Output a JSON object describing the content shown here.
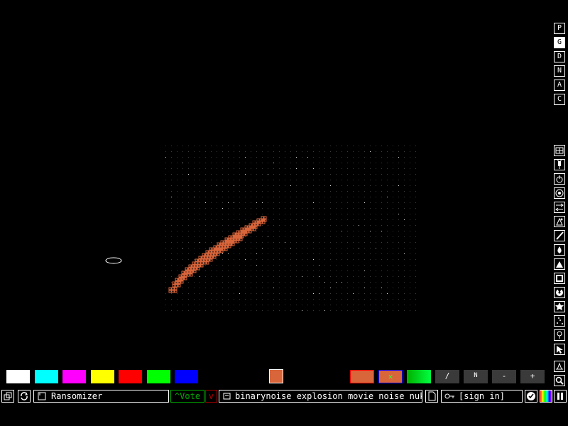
{
  "menu_categories": [
    "P",
    "G",
    "D",
    "N",
    "A",
    "C"
  ],
  "active_category_index": 1,
  "palette": [
    "#ffffff",
    "#00ffff",
    "#ff00ff",
    "#ffff00",
    "#ff0000",
    "#00ff00",
    "#0000ff"
  ],
  "selected_color": "#d9653b",
  "deco_tools": {
    "primary_color": "#d9653b",
    "clear_label": "✕",
    "line_label": "/",
    "nudge_label": "N",
    "minus_label": "-",
    "plus_label": "+"
  },
  "bottom_bar": {
    "save_title": "Ransomizer",
    "vote_label": "Vote",
    "tags": "binarynoise explosion movie noise nuke ...",
    "user_label": "[sign in]"
  },
  "sim": {
    "particle_color": "#d9653b"
  }
}
